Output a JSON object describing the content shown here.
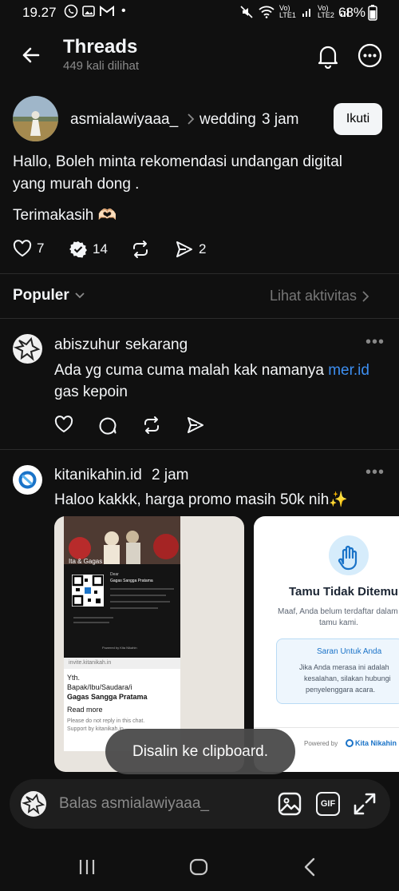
{
  "status_bar": {
    "time": "19.27",
    "battery": "68%",
    "sim1": "Vo) LTE1",
    "sim2": "Vo) LTE2",
    "icons": [
      "whatsapp-icon",
      "image-icon",
      "gmail-icon",
      "dot",
      "mute-icon",
      "wifi-icon",
      "signal-icon",
      "battery-icon"
    ]
  },
  "header": {
    "title": "Threads",
    "subtitle": "449 kali dilihat"
  },
  "post": {
    "username": "asmialawiyaaa_",
    "topic": "wedding",
    "time": "3 jam",
    "follow_label": "Ikuti",
    "text_line1": "Hallo, Boleh minta rekomendasi undangan digital",
    "text_line2": "yang murah dong .",
    "text_line3": "Terimakasih 🫶🏻",
    "likes": "7",
    "replies": "14",
    "shares": "2"
  },
  "section": {
    "title": "Populer",
    "link": "Lihat aktivitas"
  },
  "replies": [
    {
      "username": "abiszuhur",
      "time": "sekarang",
      "text_prefix": "Ada yg cuma cuma malah kak namanya ",
      "link": "mer.id",
      "text_line2": "gas kepoin"
    },
    {
      "username": "kitanikahin.id",
      "time": "2 jam",
      "text": "Haloo kakkk, harga promo masih 50k nih✨"
    }
  ],
  "media_card_1": {
    "invite_label": "Ita & Gagas",
    "dear": "Dear",
    "guest": "Gagas Sangga Pratama",
    "url": "invite.kitanikah.in",
    "yth": "Yth.",
    "recipient_line1": "Bapak/Ibu/Saudara/i",
    "recipient_line2": "Gagas Sangga Pratama",
    "read_more": "Read more",
    "footer1": "Please do not reply in this chat.",
    "footer2": "Support by kitanikah.in",
    "powered": "Powered by Kita Nikahin"
  },
  "media_card_2": {
    "title": "Tamu Tidak Ditemukan",
    "desc_line1": "Maaf, Anda belum terdaftar dalam",
    "desc_line2": "tamu kami.",
    "suggestion_title": "Saran Untuk Anda",
    "suggestion_line1": "Jika Anda merasa ini adalah",
    "suggestion_line2": "kesalahan, silakan hubungi",
    "suggestion_line3": "penyelenggara acara.",
    "powered_by": "Powered by",
    "brand": "Kita Nikahin"
  },
  "toast": "Disalin ke clipboard.",
  "composer": {
    "placeholder": "Balas asmialawiyaaa_",
    "gif_label": "GIF"
  },
  "colors": {
    "background": "#101010",
    "link": "#3d8ef0",
    "card_accent": "#1a73c8"
  }
}
